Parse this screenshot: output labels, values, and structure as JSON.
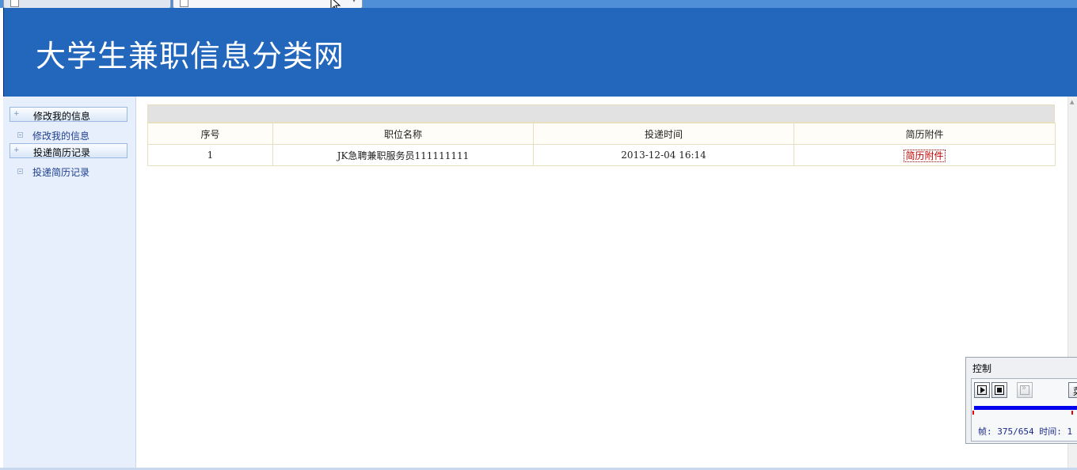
{
  "site": {
    "title": "大学生兼职信息分类网"
  },
  "sidebar": {
    "groups": [
      {
        "header": "修改我的信息",
        "item": "修改我的信息"
      },
      {
        "header": "投递简历记录",
        "item": "投递简历记录"
      }
    ]
  },
  "table": {
    "columns": [
      "序号",
      "职位名称",
      "投递时间",
      "简历附件"
    ],
    "rows": [
      {
        "index": "1",
        "position": "JK急聘兼职服务员111111111",
        "time": "2013-12-04 16:14",
        "attachment": "简历附件"
      }
    ]
  },
  "control": {
    "title": "控制",
    "more_label": "菜",
    "frame_text": "帧: 375/654 时间: 1"
  }
}
